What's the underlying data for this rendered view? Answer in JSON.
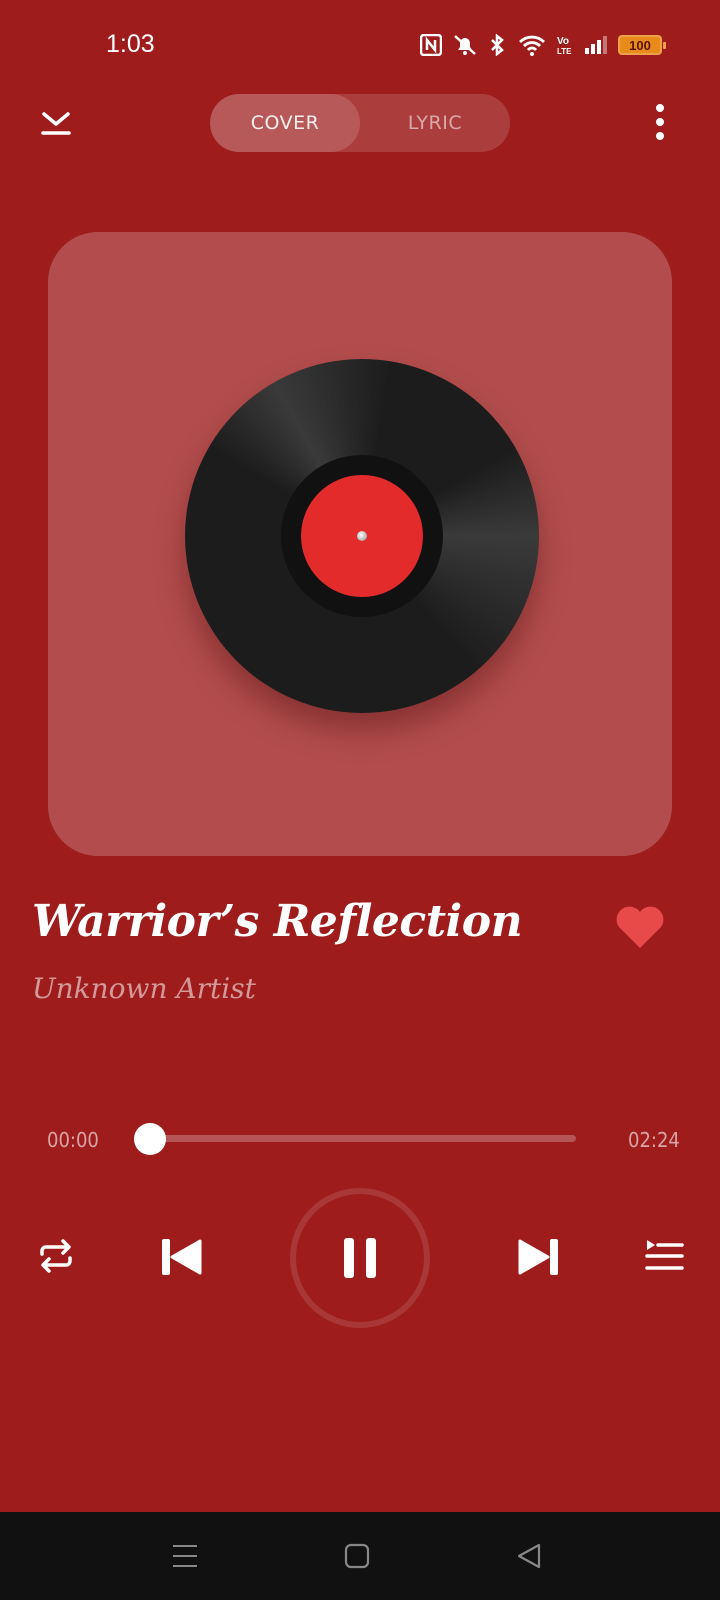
{
  "status_bar": {
    "time": "1:03",
    "battery": "100",
    "icons": [
      "nfc-icon",
      "mute-icon",
      "bluetooth-icon",
      "wifi-icon",
      "volte-icon",
      "signal-icon"
    ]
  },
  "header": {
    "tabs": [
      {
        "label": "COVER",
        "active": true
      },
      {
        "label": "LYRIC",
        "active": false
      }
    ],
    "collapse_icon": "chevron-down-icon",
    "menu_icon": "more-vertical-icon"
  },
  "cover": {
    "image": "vinyl-record",
    "label_color": "#e32b2b"
  },
  "track": {
    "title": "Warrior’s Reflection",
    "artist": "Unknown Artist",
    "favorited": true
  },
  "progress": {
    "current": "00:00",
    "total": "02:24",
    "fraction": 0.0
  },
  "controls": {
    "repeat_icon": "repeat-icon",
    "prev_icon": "skip-previous-icon",
    "play_state": "playing",
    "next_icon": "skip-next-icon",
    "queue_icon": "queue-icon"
  },
  "nav_bar": {
    "icons": [
      "menu-icon",
      "home-icon",
      "back-icon"
    ]
  },
  "colors": {
    "background": "#9e1c1c",
    "accent": "#e84a4a",
    "battery": "#e88b1a"
  }
}
